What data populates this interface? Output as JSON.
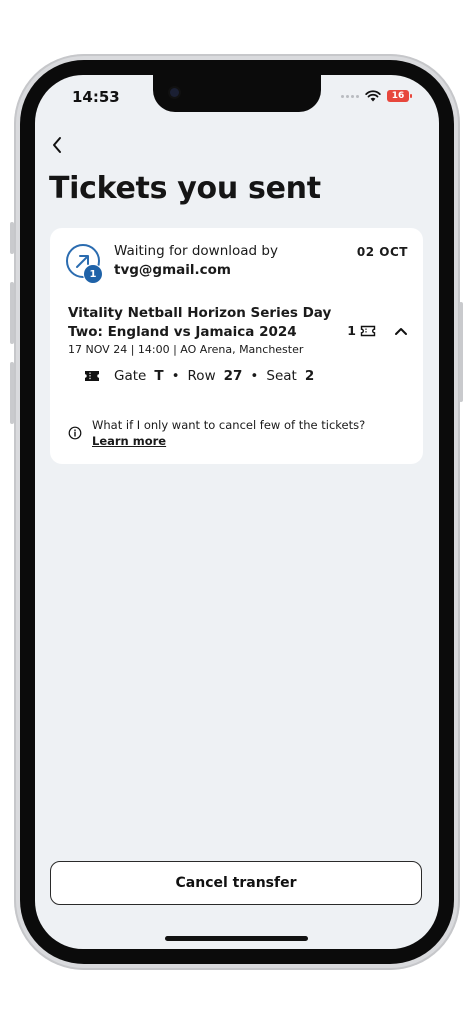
{
  "status_bar": {
    "time": "14:53",
    "battery": "16"
  },
  "header": {
    "title": "Tickets you sent"
  },
  "transfer": {
    "status_text": "Waiting for download by",
    "recipient": "tvg@gmail.com",
    "date": "02 OCT",
    "badge_count": "1",
    "event_title": "Vitality Netball Horizon Series Day Two: England vs Jamaica 2024",
    "event_meta": "17 NOV 24 | 14:00 | AO Arena, Manchester",
    "ticket_qty": "1",
    "seat": {
      "gate_label": "Gate",
      "gate": "T",
      "row_label": "Row",
      "row": "27",
      "seat_label": "Seat",
      "seat": "2",
      "separator": "•"
    },
    "info_text": "What if I only want to cancel few of the tickets?",
    "learn_more": "Learn more"
  },
  "actions": {
    "cancel_label": "Cancel transfer"
  },
  "colors": {
    "accent": "#1f62a8",
    "battery": "#e7473c",
    "screen_bg": "#eef1f4"
  },
  "icons": [
    "back-chevron-icon",
    "send-arrow-icon",
    "ticket-icon",
    "chevron-up-icon",
    "info-icon",
    "wifi-icon",
    "battery-icon"
  ]
}
